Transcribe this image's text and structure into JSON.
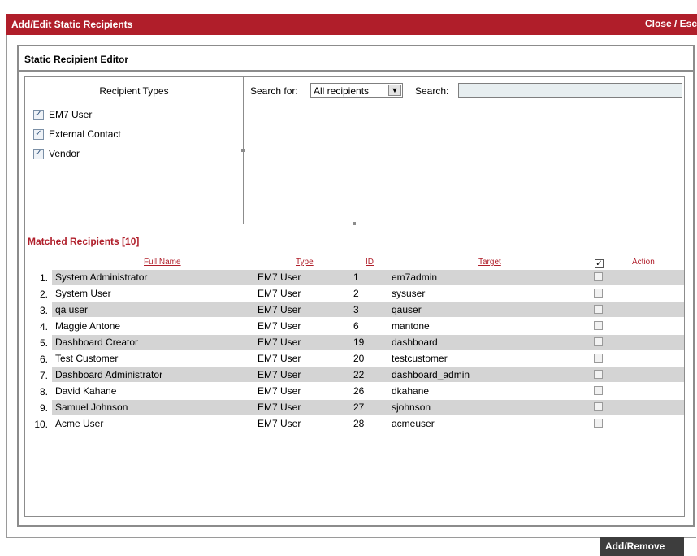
{
  "window": {
    "title": "Add/Edit Static Recipients",
    "close_label": "Close / Esc"
  },
  "editor": {
    "title": "Static Recipient Editor"
  },
  "recipient_types": {
    "title": "Recipient Types",
    "items": [
      {
        "label": "EM7 User",
        "checked": true
      },
      {
        "label": "External Contact",
        "checked": true
      },
      {
        "label": "Vendor",
        "checked": true
      }
    ]
  },
  "search": {
    "for_label": "Search for:",
    "for_value": "All recipients",
    "search_label": "Search:",
    "search_value": ""
  },
  "matched": {
    "title": "Matched Recipients [10]",
    "columns": {
      "name": "Full Name",
      "type": "Type",
      "id": "ID",
      "target": "Target",
      "action": "Action"
    },
    "rows": [
      {
        "num": "1.",
        "name": "System Administrator",
        "type": "EM7 User",
        "id": "1",
        "target": "em7admin"
      },
      {
        "num": "2.",
        "name": "System User",
        "type": "EM7 User",
        "id": "2",
        "target": "sysuser"
      },
      {
        "num": "3.",
        "name": "qa user",
        "type": "EM7 User",
        "id": "3",
        "target": "qauser"
      },
      {
        "num": "4.",
        "name": "Maggie Antone",
        "type": "EM7 User",
        "id": "6",
        "target": "mantone"
      },
      {
        "num": "5.",
        "name": "Dashboard Creator",
        "type": "EM7 User",
        "id": "19",
        "target": "dashboard"
      },
      {
        "num": "6.",
        "name": "Test Customer",
        "type": "EM7 User",
        "id": "20",
        "target": "testcustomer"
      },
      {
        "num": "7.",
        "name": "Dashboard Administrator",
        "type": "EM7 User",
        "id": "22",
        "target": "dashboard_admin"
      },
      {
        "num": "8.",
        "name": "David Kahane",
        "type": "EM7 User",
        "id": "26",
        "target": "dkahane"
      },
      {
        "num": "9.",
        "name": "Samuel Johnson",
        "type": "EM7 User",
        "id": "27",
        "target": "sjohnson"
      },
      {
        "num": "10.",
        "name": "Acme User",
        "type": "EM7 User",
        "id": "28",
        "target": "acmeuser"
      }
    ]
  },
  "buttons": {
    "add_remove": "Add/Remove"
  },
  "colors": {
    "accent": "#b01e2a",
    "row_shade": "#d4d4d4",
    "button_dark": "#3d3d3d"
  }
}
